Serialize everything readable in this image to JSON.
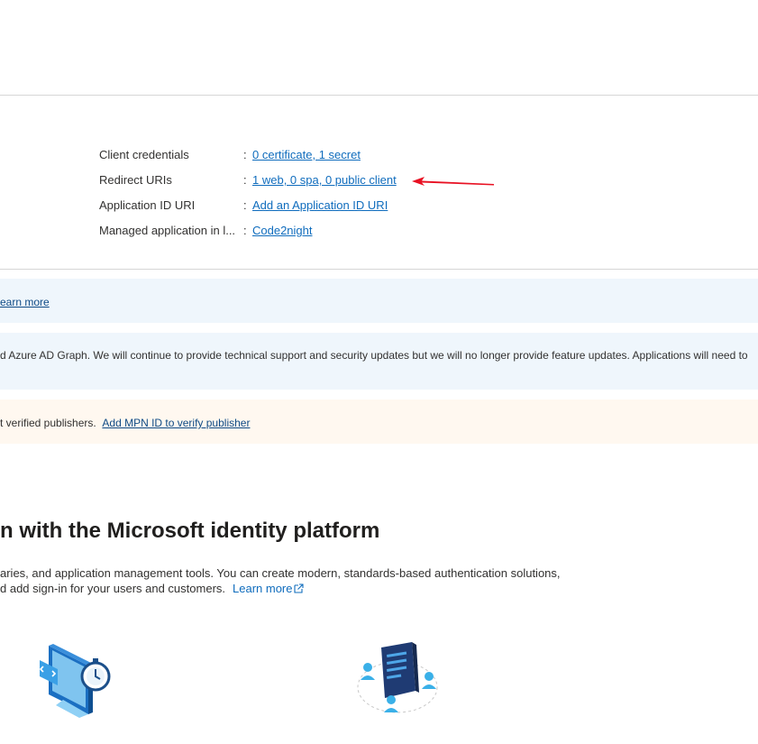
{
  "essentials": {
    "rows": [
      {
        "label": "Client credentials",
        "value": "0 certificate, 1 secret"
      },
      {
        "label": "Redirect URIs",
        "value": "1 web, 0 spa, 0 public client"
      },
      {
        "label": "Application ID URI",
        "value": "Add an Application ID URI"
      },
      {
        "label": "Managed application in l...",
        "value": "Code2night"
      }
    ],
    "separator": ":"
  },
  "banners": {
    "info1": {
      "link": "earn more"
    },
    "info2": {
      "text": "d Azure AD Graph. We will continue to provide technical support and security updates but we will no longer provide feature updates. Applications will need to"
    },
    "warn": {
      "text": "t verified publishers.",
      "link": "Add MPN ID to verify publisher"
    }
  },
  "hero": {
    "title": "n with the Microsoft identity platform",
    "line1": "aries, and application management tools. You can create modern, standards-based authentication solutions,",
    "line2": "d add sign-in for your users and customers.",
    "learn_more": "Learn more"
  },
  "colors": {
    "link": "#0f6cbd",
    "annotation_arrow": "#e81123",
    "info_banner": "#eff6fc",
    "warning_banner": "#fff8f0"
  }
}
